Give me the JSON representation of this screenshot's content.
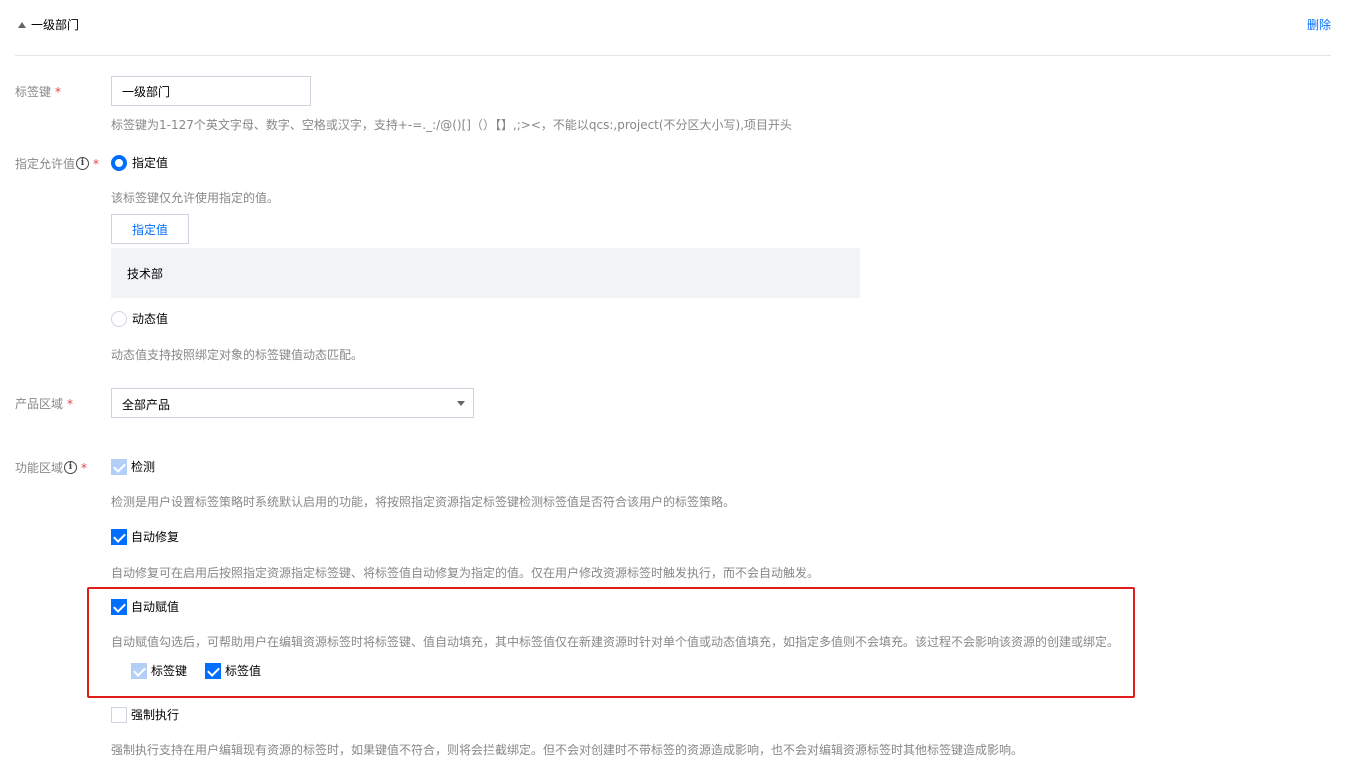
{
  "header": {
    "title": "一级部门",
    "delete_label": "删除"
  },
  "tag_key": {
    "label": "标签键",
    "required": "*",
    "value": "一级部门",
    "help": "标签键为1-127个英文字母、数字、空格或汉字，支持+-=._:/@()[]（）【】,;><，不能以qcs:,project(不分区大小写),项目开头"
  },
  "allowed_values": {
    "label": "指定允许值",
    "required": "*",
    "info_icon": "i",
    "specified": {
      "label": "指定值",
      "checked": true,
      "help": "该标签键仅允许使用指定的值。",
      "button_label": "指定值",
      "values": [
        "技术部"
      ]
    },
    "dynamic": {
      "label": "动态值",
      "checked": false,
      "help": "动态值支持按照绑定对象的标签键值动态匹配。"
    }
  },
  "product_scope": {
    "label": "产品区域",
    "required": "*",
    "selected": "全部产品"
  },
  "feature_scope": {
    "label": "功能区域",
    "required": "*",
    "info_icon": "i",
    "detect": {
      "label": "检测",
      "checked": true,
      "disabled": true,
      "help": "检测是用户设置标签策略时系统默认启用的功能，将按照指定资源指定标签键检测标签值是否符合该用户的标签策略。"
    },
    "auto_repair": {
      "label": "自动修复",
      "checked": true,
      "help": "自动修复可在启用后按照指定资源指定标签键、将标签值自动修复为指定的值。仅在用户修改资源标签时触发执行，而不会自动触发。"
    },
    "auto_assign": {
      "label": "自动赋值",
      "checked": true,
      "help": "自动赋值勾选后，可帮助用户在编辑资源标签时将标签键、值自动填充，其中标签值仅在新建资源时针对单个值或动态值填充，如指定多值则不会填充。该过程不会影响该资源的创建或绑定。",
      "sub_key": {
        "label": "标签键",
        "checked": true,
        "disabled": true
      },
      "sub_value": {
        "label": "标签值",
        "checked": true
      }
    },
    "enforce": {
      "label": "强制执行",
      "checked": false,
      "help": "强制执行支持在用户编辑现有资源的标签时，如果键值不符合，则将会拦截绑定。但不会对创建时不带标签的资源造成影响，也不会对编辑资源标签时其他标签键造成影响。"
    }
  },
  "colors": {
    "primary": "#006eff",
    "required": "#e54545",
    "highlight": "#e21b1b"
  }
}
